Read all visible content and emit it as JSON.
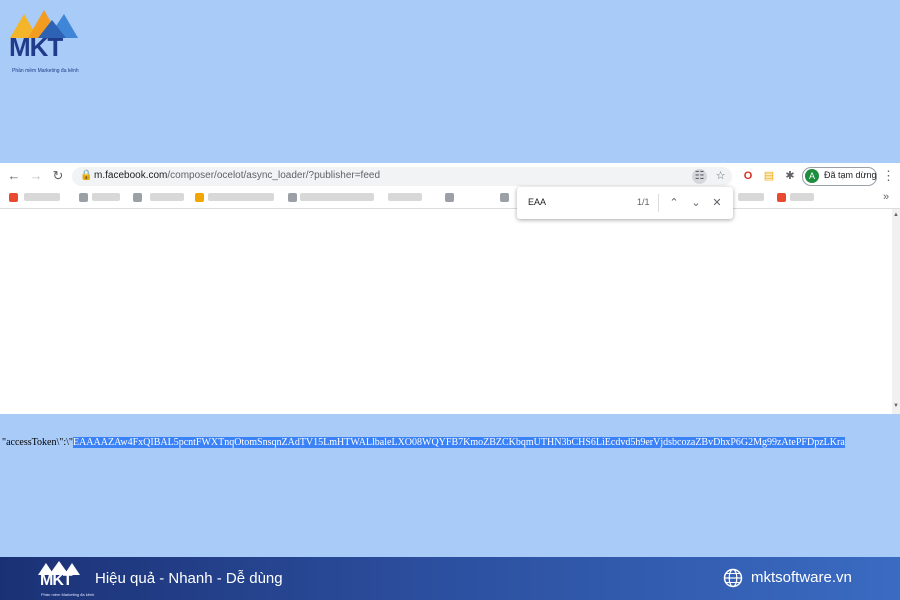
{
  "brand": {
    "logo_text": "MKT",
    "tagline": "Phần mềm Marketing đa kênh",
    "slogan": "Hiệu quả - Nhanh - Dễ dùng",
    "website": "mktsoftware.vn"
  },
  "browser": {
    "url_host": "m.facebook.com",
    "url_path": "/composer/ocelot/async_loader/?publisher=feed",
    "profile_label": "Đã tạm dừng",
    "profile_initial": "A",
    "find": {
      "query": "EAA",
      "count": "1/1"
    }
  },
  "page": {
    "token_prefix": "\"accessToken\\\":\\\"",
    "token_value": "EAAAAZAw4FxQIBAL5pcntFWXTnqOtomSnsqnZAdTV15LmHTWALlbaleLXO08WQYFB7KmoZBZCKbqmUTHN3bCHS6LiEcdvd5h9erVjdsbcozaZBvDhxP6G2Mg99zAtePFDpzLKra"
  },
  "colors": {
    "background": "#a9cbf7",
    "highlight": "#3b82f6",
    "footer_start": "#1b3175",
    "footer_end": "#3a6bc2",
    "brand_dark": "#1f3b8a"
  },
  "icons": [
    "back-icon",
    "forward-icon",
    "reload-icon",
    "home-icon",
    "lock-icon",
    "bookmark-star-icon",
    "extension-icon",
    "menu-icon",
    "globe-icon"
  ]
}
